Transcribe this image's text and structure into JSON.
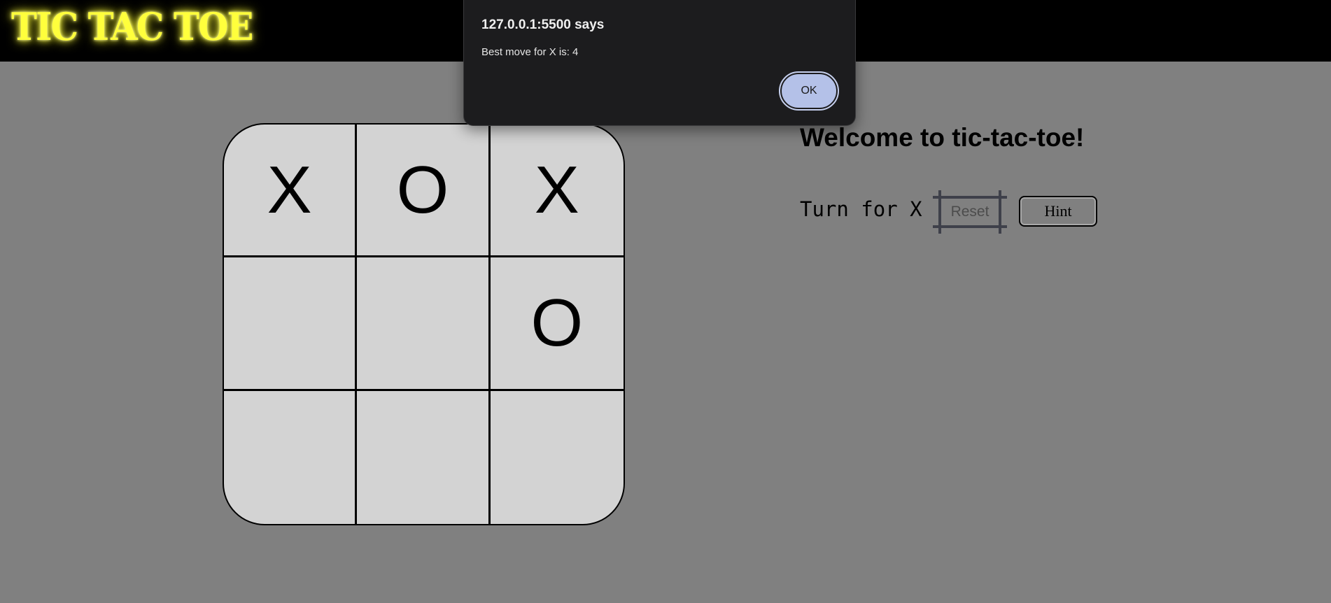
{
  "header": {
    "logo_text": "TIC TAC TOE"
  },
  "board": {
    "cells": [
      "X",
      "O",
      "X",
      "",
      "",
      "O",
      "",
      "",
      ""
    ]
  },
  "panel": {
    "welcome": "Welcome to tic-tac-toe!",
    "turn_text": "Turn for X",
    "reset_label": "Reset",
    "hint_label": "Hint"
  },
  "dialog": {
    "title": "127.0.0.1:5500 says",
    "message": "Best move for X is: 4",
    "ok_label": "OK"
  },
  "colors": {
    "page_background": "#808080",
    "header_background": "#000000",
    "logo": "#ffff3c",
    "board": "#d3d3d3",
    "dialog_background": "#1c1c1e",
    "ok_button": "#b4c1e8"
  }
}
